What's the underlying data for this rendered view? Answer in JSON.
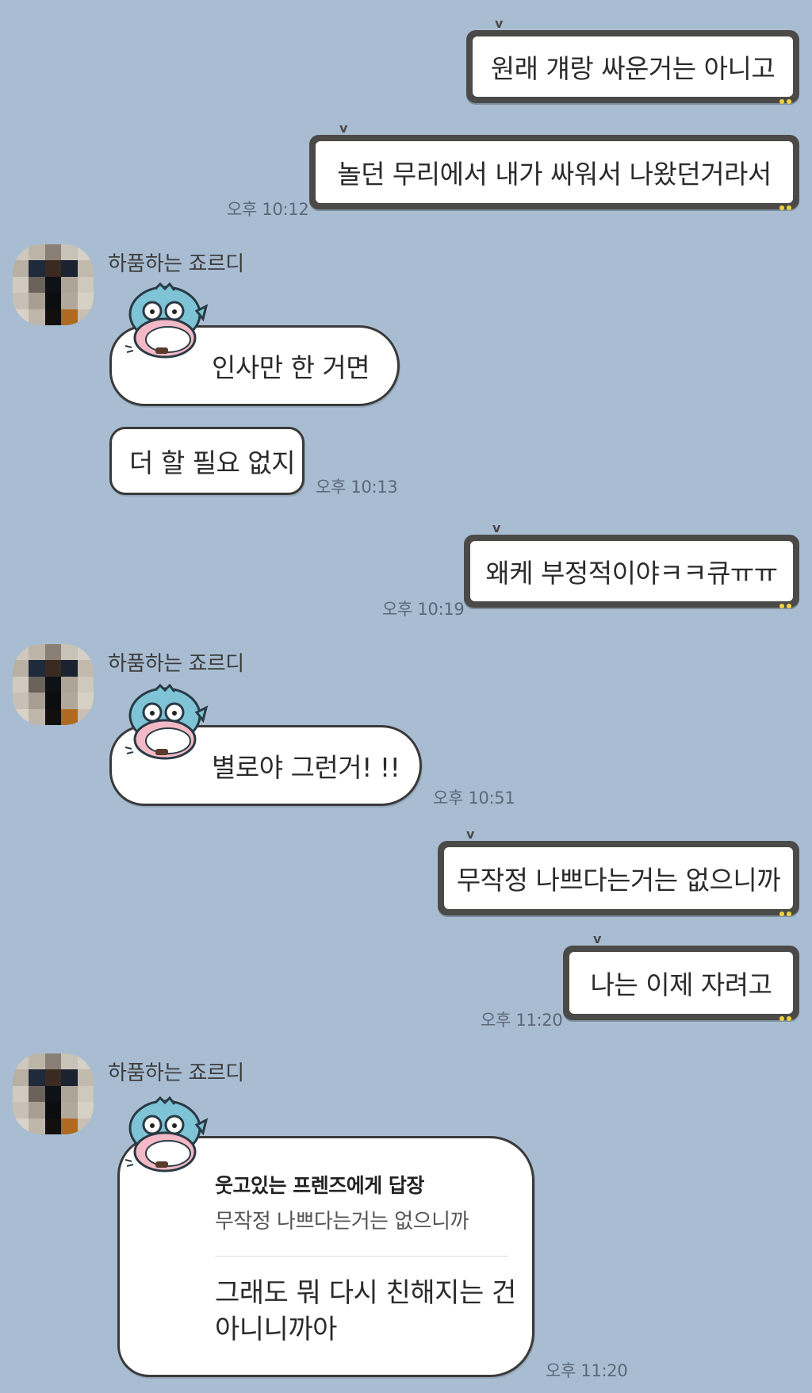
{
  "chat": {
    "outgoing_1": {
      "text": "원래 걔랑 싸운거는 아니고"
    },
    "outgoing_2": {
      "text": "놀던 무리에서 내가 싸워서 나왔던거라서",
      "time": "오후 10:12"
    },
    "incoming_group_1": {
      "sender": "하품하는 죠르디",
      "sticker_text": "인사만 한 거면",
      "text": "더 할 필요 없지",
      "time": "오후 10:13",
      "sticker_icon": "hangyodon-fish-sticker"
    },
    "outgoing_3": {
      "text": "왜케 부정적이야ㅋㅋ큐ㅠㅠ",
      "time": "오후 10:19"
    },
    "incoming_group_2": {
      "sender": "하품하는 죠르디",
      "sticker_text": "별로야 그런거! !!",
      "time": "오후 10:51",
      "sticker_icon": "hangyodon-fish-sticker"
    },
    "outgoing_4": {
      "text": "무작정 나쁘다는거는 없으니까"
    },
    "outgoing_5": {
      "text": "나는 이제 자려고",
      "time": "오후 11:20"
    },
    "incoming_group_3": {
      "sender": "하품하는 죠르디",
      "reply_title": "웃고있는 프렌즈에게 답장",
      "reply_quote": "무작정 나쁘다는거는 없으니까",
      "reply_line1": "그래도 뭐 다시 친해지는 건",
      "reply_line2": "아니니까아",
      "time": "오후 11:20",
      "sticker_icon": "hangyodon-fish-sticker"
    }
  },
  "colors": {
    "background": "#a9bdd2",
    "outgoing_frame": "#4b4a48",
    "frame_dots": "#f4d43b",
    "bubble_bg": "#ffffff",
    "timestamp": "#5b6878"
  },
  "avatar_icon": "pixelated-profile-avatar"
}
